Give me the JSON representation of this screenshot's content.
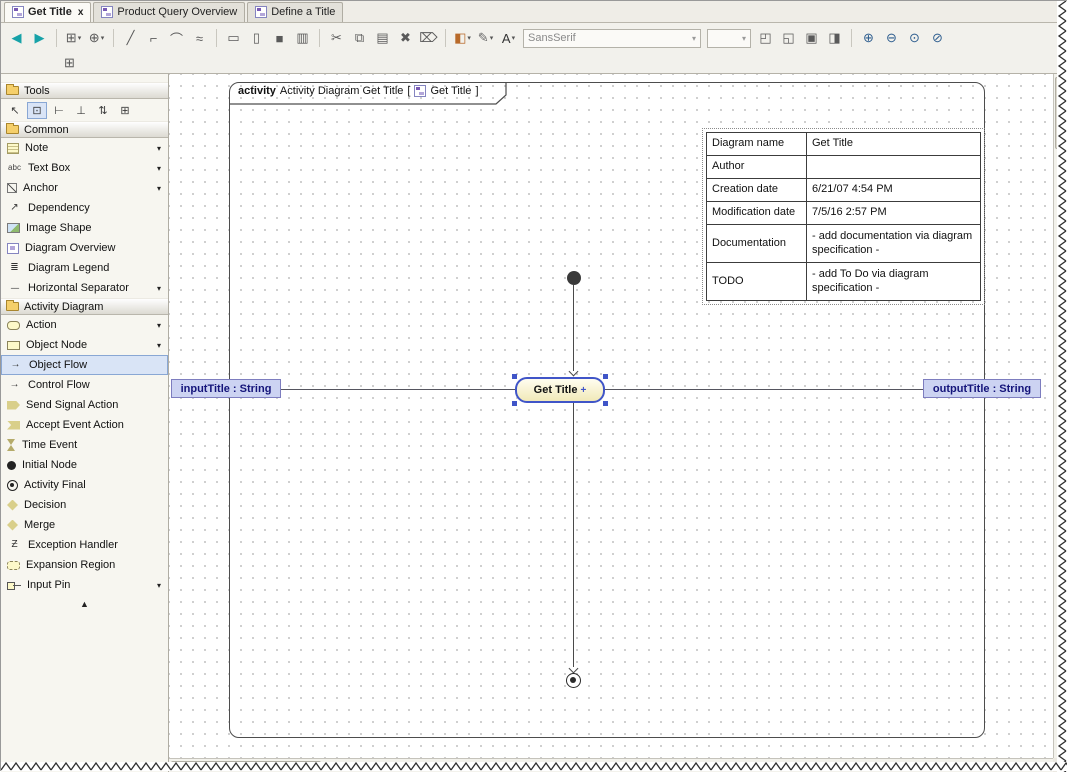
{
  "tabs": [
    {
      "icon": "activity-diagram-icon",
      "label": "Get Title",
      "close_glyph": "x",
      "active": true
    },
    {
      "icon": "activity-diagram-icon",
      "label": "Product Query Overview",
      "active": false
    },
    {
      "icon": "activity-diagram-icon",
      "label": "Define a Title",
      "active": false
    }
  ],
  "toolbar": {
    "buttons": [
      {
        "name": "back",
        "glyph": "◀",
        "color": "#17a2a8"
      },
      {
        "name": "forward",
        "glyph": "▶",
        "color": "#17a2a8"
      },
      {
        "type": "sep"
      },
      {
        "name": "quick-layout",
        "glyph": "⊞",
        "caret": true
      },
      {
        "name": "add-related-elements",
        "glyph": "⊕",
        "caret": true
      },
      {
        "type": "sep"
      },
      {
        "name": "oblique-path-style",
        "glyph": "╱"
      },
      {
        "name": "rectilinear-path-style",
        "glyph": "⌐"
      },
      {
        "name": "curved-path-style",
        "glyph": "⌒"
      },
      {
        "name": "custom-path-style",
        "glyph": "≈"
      },
      {
        "type": "sep"
      },
      {
        "name": "make-same-width",
        "glyph": "▭"
      },
      {
        "name": "make-same-height",
        "glyph": "▯"
      },
      {
        "name": "make-same-size",
        "glyph": "■"
      },
      {
        "name": "align-shapes",
        "glyph": "▥"
      },
      {
        "type": "sep"
      },
      {
        "name": "cut",
        "glyph": "✂"
      },
      {
        "name": "copy",
        "glyph": "⧉"
      },
      {
        "name": "paste",
        "glyph": "▤"
      },
      {
        "name": "delete-symbol",
        "glyph": "✖"
      },
      {
        "name": "delete-from-model",
        "glyph": "⌦"
      },
      {
        "type": "sep"
      },
      {
        "name": "fill-color",
        "glyph": "◧",
        "caret": true,
        "color": "#b86a2a"
      },
      {
        "name": "line-color",
        "glyph": "✎",
        "caret": true,
        "color": "#6a6a6a"
      },
      {
        "name": "font-color",
        "glyph": "A",
        "caret": true,
        "color": "#333333"
      },
      {
        "type": "combo",
        "name": "font-family",
        "value": "SansSerif",
        "w": 178
      },
      {
        "type": "combo",
        "name": "font-size",
        "value": "",
        "w": 44
      },
      {
        "name": "bring-to-front",
        "glyph": "◰"
      },
      {
        "name": "send-to-back",
        "glyph": "◱"
      },
      {
        "name": "group",
        "glyph": "▣"
      },
      {
        "name": "refresh-diagram",
        "glyph": "◨"
      },
      {
        "type": "sep"
      },
      {
        "name": "zoom-in",
        "glyph": "⊕",
        "color": "#2f5e8f"
      },
      {
        "name": "zoom-out",
        "glyph": "⊖",
        "color": "#2f5e8f"
      },
      {
        "name": "fit-in-window",
        "glyph": "⊙",
        "color": "#2f5e8f"
      },
      {
        "name": "zoom-selection",
        "glyph": "⊘",
        "color": "#2f5e8f"
      }
    ]
  },
  "toolbar2": {
    "buttons": [
      {
        "name": "show-containment",
        "glyph": "⊞"
      }
    ]
  },
  "sidebar": {
    "scroll_up_glyph": "▲",
    "sections": [
      {
        "id": "tools",
        "title": "Tools",
        "tools": [
          {
            "name": "select",
            "glyph": "↖"
          },
          {
            "name": "drag-select",
            "glyph": "⊡",
            "pressed": true
          },
          {
            "name": "align-left",
            "glyph": "⊢"
          },
          {
            "name": "align-bottom",
            "glyph": "⊥"
          },
          {
            "name": "distribute",
            "glyph": "⇅"
          },
          {
            "name": "resize-tool",
            "glyph": "⊞"
          }
        ]
      },
      {
        "id": "common",
        "title": "Common",
        "items": [
          {
            "id": "note",
            "label": "Note",
            "dropdown": true
          },
          {
            "id": "text-box",
            "label": "Text Box",
            "dropdown": true,
            "icon_text": "abc"
          },
          {
            "id": "anchor",
            "label": "Anchor",
            "dropdown": true
          },
          {
            "id": "dependency",
            "label": "Dependency",
            "icon_text": "↗"
          },
          {
            "id": "image-shape",
            "label": "Image Shape"
          },
          {
            "id": "diagram-overview",
            "label": "Diagram Overview"
          },
          {
            "id": "diagram-legend",
            "label": "Diagram Legend",
            "icon_text": "≣"
          },
          {
            "id": "horizontal-separator",
            "label": "Horizontal Separator",
            "dropdown": true,
            "icon_text": "----"
          }
        ]
      },
      {
        "id": "activity-diagram",
        "title": "Activity Diagram",
        "items": [
          {
            "id": "action",
            "label": "Action",
            "dropdown": true
          },
          {
            "id": "object-node",
            "label": "Object Node",
            "dropdown": true
          },
          {
            "id": "object-flow",
            "label": "Object Flow",
            "selected": true,
            "icon_text": "→"
          },
          {
            "id": "control-flow",
            "label": "Control Flow",
            "icon_text": "→"
          },
          {
            "id": "send-signal-action",
            "label": "Send Signal Action"
          },
          {
            "id": "accept-event-action",
            "label": "Accept Event Action"
          },
          {
            "id": "time-event",
            "label": "Time Event"
          },
          {
            "id": "initial-node",
            "label": "Initial Node"
          },
          {
            "id": "activity-final",
            "label": "Activity Final"
          },
          {
            "id": "decision",
            "label": "Decision"
          },
          {
            "id": "merge",
            "label": "Merge"
          },
          {
            "id": "exception-handler",
            "label": "Exception Handler",
            "icon_text": "Ƶ"
          },
          {
            "id": "expansion-region",
            "label": "Expansion Region"
          },
          {
            "id": "input-pin",
            "label": "Input Pin",
            "dropdown": true
          }
        ]
      }
    ]
  },
  "canvas": {
    "frame": {
      "keyword": "activity",
      "title": "Activity Diagram Get Title",
      "bracket_open": "[",
      "inner_name": "Get Title",
      "bracket_close": "]"
    },
    "info_table": {
      "rows": [
        {
          "name": "Diagram name",
          "value": "Get Title"
        },
        {
          "name": "Author",
          "value": ""
        },
        {
          "name": "Creation date",
          "value": "6/21/07 4:54 PM"
        },
        {
          "name": "Modification date",
          "value": "7/5/16 2:57 PM"
        },
        {
          "name": "Documentation",
          "value": "- add documentation via diagram specification -",
          "tall": true
        },
        {
          "name": "TODO",
          "value": "- add To Do via diagram specification -",
          "tall": true
        }
      ]
    },
    "action": {
      "label": "Get Title",
      "manipulator_glyph": "+"
    },
    "input_pin_label": "inputTitle : String",
    "output_pin_label": "outputTitle : String"
  },
  "colors": {
    "selection_blue": "#4055c8",
    "pin_label_bg": "#ccd3f2",
    "action_fill": "#fdf9d8",
    "nav_arrow_teal": "#17a2a8"
  }
}
